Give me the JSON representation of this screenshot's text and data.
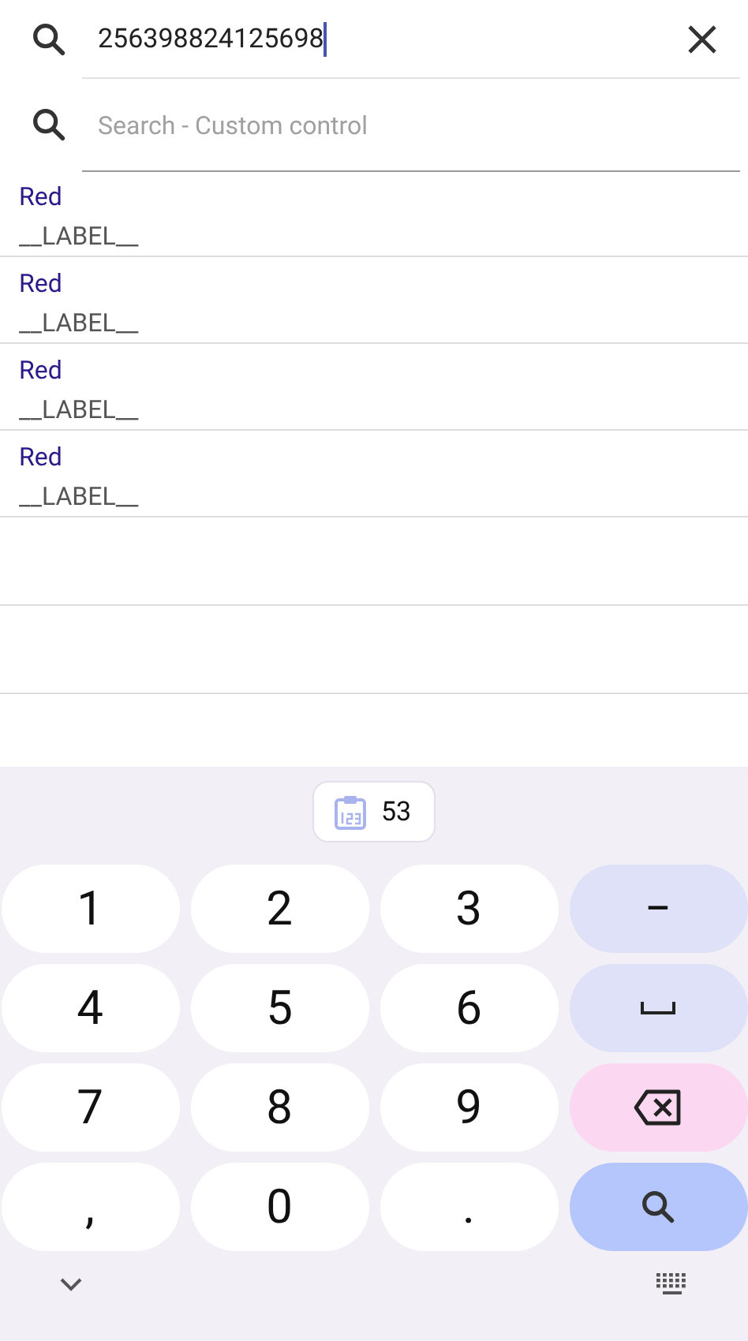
{
  "search_bar": {
    "value": "256398824125698"
  },
  "custom_search": {
    "placeholder": "Search - Custom control"
  },
  "results": [
    {
      "title": "Red",
      "subtitle": "__LABEL__"
    },
    {
      "title": "Red",
      "subtitle": "__LABEL__"
    },
    {
      "title": "Red",
      "subtitle": "__LABEL__"
    },
    {
      "title": "Red",
      "subtitle": "__LABEL__"
    }
  ],
  "keyboard": {
    "suggestion": "53",
    "rows": [
      [
        {
          "kind": "char",
          "label": "1"
        },
        {
          "kind": "char",
          "label": "2"
        },
        {
          "kind": "char",
          "label": "3"
        },
        {
          "kind": "symbol",
          "label": "−"
        }
      ],
      [
        {
          "kind": "char",
          "label": "4"
        },
        {
          "kind": "char",
          "label": "5"
        },
        {
          "kind": "char",
          "label": "6"
        },
        {
          "kind": "space"
        }
      ],
      [
        {
          "kind": "char",
          "label": "7"
        },
        {
          "kind": "char",
          "label": "8"
        },
        {
          "kind": "char",
          "label": "9"
        },
        {
          "kind": "backspace"
        }
      ],
      [
        {
          "kind": "char",
          "label": ","
        },
        {
          "kind": "char",
          "label": "0"
        },
        {
          "kind": "char",
          "label": "."
        },
        {
          "kind": "search"
        }
      ]
    ]
  }
}
